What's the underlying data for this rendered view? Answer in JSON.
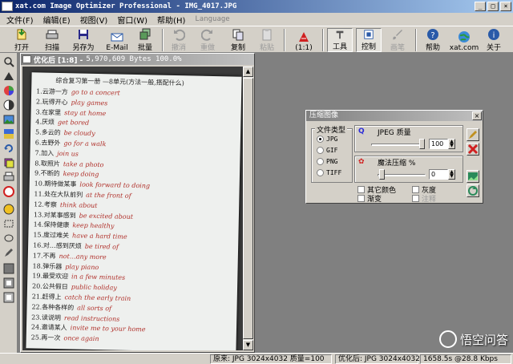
{
  "window": {
    "title": "xat.com   Image Optimizer Professional - IMG_4017.JPG",
    "controls": [
      "_",
      "□",
      "×"
    ]
  },
  "menu": {
    "items": [
      "文件(F)",
      "编辑(E)",
      "视图(V)",
      "窗口(W)",
      "帮助(H)"
    ],
    "language": "Language"
  },
  "toolbar": {
    "buttons": [
      {
        "label": "打开",
        "icon": "open-icon",
        "disabled": false
      },
      {
        "label": "扫描",
        "icon": "scan-icon",
        "disabled": false
      },
      {
        "label": "另存为",
        "icon": "save-as-icon",
        "disabled": false
      },
      {
        "label": "E-Mail",
        "icon": "email-icon",
        "disabled": false
      },
      {
        "label": "批量",
        "icon": "batch-icon",
        "disabled": false
      },
      {
        "label": "撤消",
        "icon": "undo-icon",
        "disabled": true
      },
      {
        "label": "重做",
        "icon": "redo-icon",
        "disabled": true
      },
      {
        "label": "复制",
        "icon": "copy-icon",
        "disabled": false
      },
      {
        "label": "粘贴",
        "icon": "paste-icon",
        "disabled": true
      },
      {
        "label": "(1:1)",
        "icon": "actual-size-icon",
        "disabled": false
      },
      {
        "label": "工具",
        "icon": "tools-icon",
        "disabled": false
      },
      {
        "label": "控制",
        "icon": "control-icon",
        "disabled": false
      },
      {
        "label": "画笔",
        "icon": "brush-icon",
        "disabled": true
      },
      {
        "label": "帮助",
        "icon": "help-icon",
        "disabled": false
      },
      {
        "label": "xat.com",
        "icon": "globe-icon",
        "disabled": false
      },
      {
        "label": "关于",
        "icon": "about-icon",
        "disabled": false
      }
    ]
  },
  "child_window": {
    "title": "优化后 [1:8] -",
    "info": "5,970,609 Bytes 100.0%"
  },
  "paper": {
    "header": "综合复习第一册 —8单元(方法一般,搭配什么)",
    "lines": [
      {
        "zh": "1.云游一方",
        "en": "go to a concert"
      },
      {
        "zh": "2.玩得开心",
        "en": "play games"
      },
      {
        "zh": "3.在家里",
        "en": "stay at home"
      },
      {
        "zh": "4.厌烦",
        "en": "get bored"
      },
      {
        "zh": "5.多云的",
        "en": "be cloudy"
      },
      {
        "zh": "6.去野外",
        "en": "go for a walk"
      },
      {
        "zh": "7.加入",
        "en": "join us"
      },
      {
        "zh": "8.取照片",
        "en": "take a photo"
      },
      {
        "zh": "9.不断的",
        "en": "keep doing"
      },
      {
        "zh": "10.期待做某事",
        "en": "look forward to doing"
      },
      {
        "zh": "11.处在大队前列",
        "en": "at the front of"
      },
      {
        "zh": "12.考察",
        "en": "think about"
      },
      {
        "zh": "13.对某事感到",
        "en": "be excited about"
      },
      {
        "zh": "14.保持健康",
        "en": "keep healthy"
      },
      {
        "zh": "15.度过难关",
        "en": "have a hard time"
      },
      {
        "zh": "16.对…感到厌烦",
        "en": "be tired of"
      },
      {
        "zh": "17.不再",
        "en": "not…any more"
      },
      {
        "zh": "18.弹乐器",
        "en": "play piano"
      },
      {
        "zh": "19.最受欢迎",
        "en": "in a few minutes"
      },
      {
        "zh": "20.公共假日",
        "en": "public holiday"
      },
      {
        "zh": "21.赶得上",
        "en": "catch the early train"
      },
      {
        "zh": "22.各种各样的",
        "en": "all sorts of"
      },
      {
        "zh": "23.读说明",
        "en": "read instructions"
      },
      {
        "zh": "24.邀请某人",
        "en": "invite me to your home"
      },
      {
        "zh": "25.再一次",
        "en": "once again"
      }
    ]
  },
  "dialog": {
    "title": "压缩图像",
    "close": "×",
    "file_type_label": "文件类型",
    "file_types": [
      "JPG",
      "GIF",
      "PNG",
      "TIFF"
    ],
    "selected_type": "JPG",
    "jpeg_quality_label": "JPEG 质量",
    "jpeg_quality_value": "100",
    "magic_label": "魔法压缩 %",
    "magic_value": "0",
    "checkboxes": [
      {
        "label": "其它颜色",
        "disabled": false
      },
      {
        "label": "灰度",
        "disabled": false
      },
      {
        "label": "渐变",
        "disabled": false
      },
      {
        "label": "注释",
        "disabled": true
      }
    ]
  },
  "status": {
    "original": "原来: JPG 3024x4032  质量=100",
    "optimized": "优化后: JPG 3024x4032",
    "speed": "1658.5s @28.8 Kbps"
  },
  "watermark": {
    "text": "悟空问答"
  },
  "colors": {
    "title_active": "#0a246a",
    "title_gradient_end": "#a6caf0",
    "face": "#d4d0c8",
    "workspace": "#808080",
    "ink_red": "#b0302a"
  }
}
